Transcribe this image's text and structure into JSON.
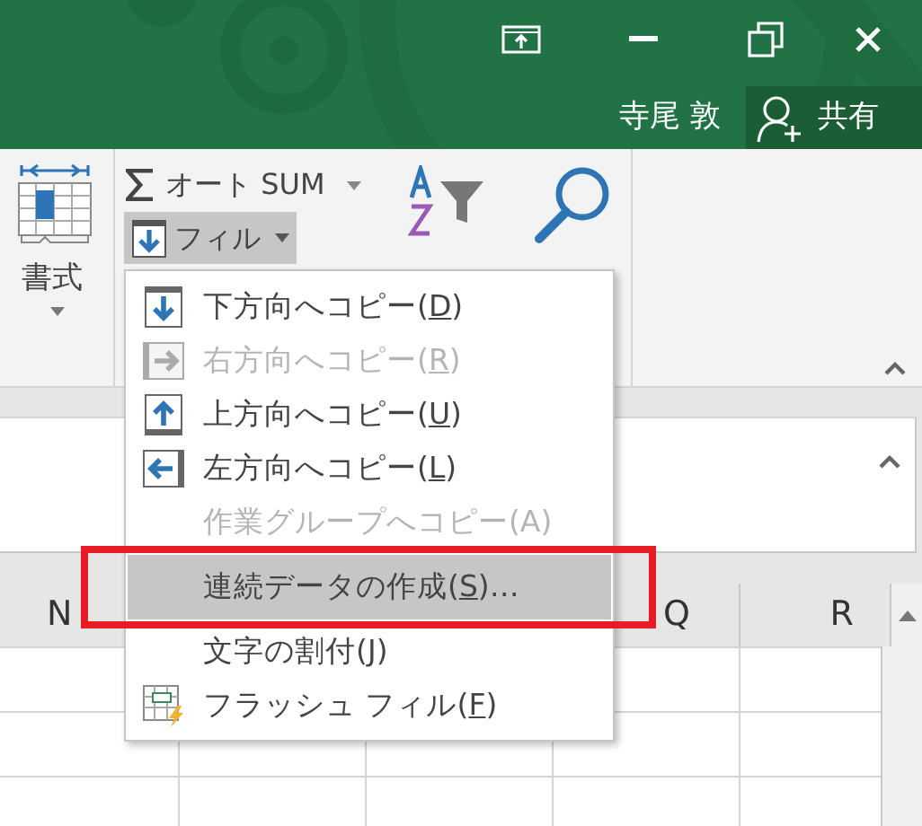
{
  "title_bar": {
    "user_name": "寺尾 敦",
    "share_label": "共有"
  },
  "ribbon": {
    "format_label": "書式",
    "autosum_label": "オート SUM",
    "fill_label": "フィル",
    "fill_pressed": true
  },
  "columns": [
    "N",
    "Q",
    "R"
  ],
  "fill_menu": {
    "items": [
      {
        "kind": "down",
        "label_before": "下方向へコピー(",
        "access_key": "D",
        "label_after": ")",
        "disabled": false,
        "selected": false
      },
      {
        "kind": "right",
        "label_before": "右方向へコピー(",
        "access_key": "R",
        "label_after": ")",
        "disabled": true,
        "selected": false
      },
      {
        "kind": "up",
        "label_before": "上方向へコピー(",
        "access_key": "U",
        "label_after": ")",
        "disabled": false,
        "selected": false
      },
      {
        "kind": "left",
        "label_before": "左方向へコピー(",
        "access_key": "L",
        "label_after": ")",
        "disabled": false,
        "selected": false
      },
      {
        "kind": "plain",
        "label_before": "作業グループへコピー(A)",
        "disabled": true,
        "selected": false
      },
      {
        "kind": "plain",
        "label_before": "連続データの作成(",
        "access_key": "S",
        "label_after": ")…",
        "disabled": false,
        "selected": true
      },
      {
        "kind": "plain",
        "label_before": "文字の割付(",
        "access_key": "J",
        "label_after": ")",
        "disabled": false,
        "selected": false
      },
      {
        "kind": "flash",
        "label_before": "フラッシュ フィル(",
        "access_key": "F",
        "label_after": ")",
        "disabled": false,
        "selected": false
      }
    ]
  },
  "annotation": {
    "kind": "frame"
  }
}
